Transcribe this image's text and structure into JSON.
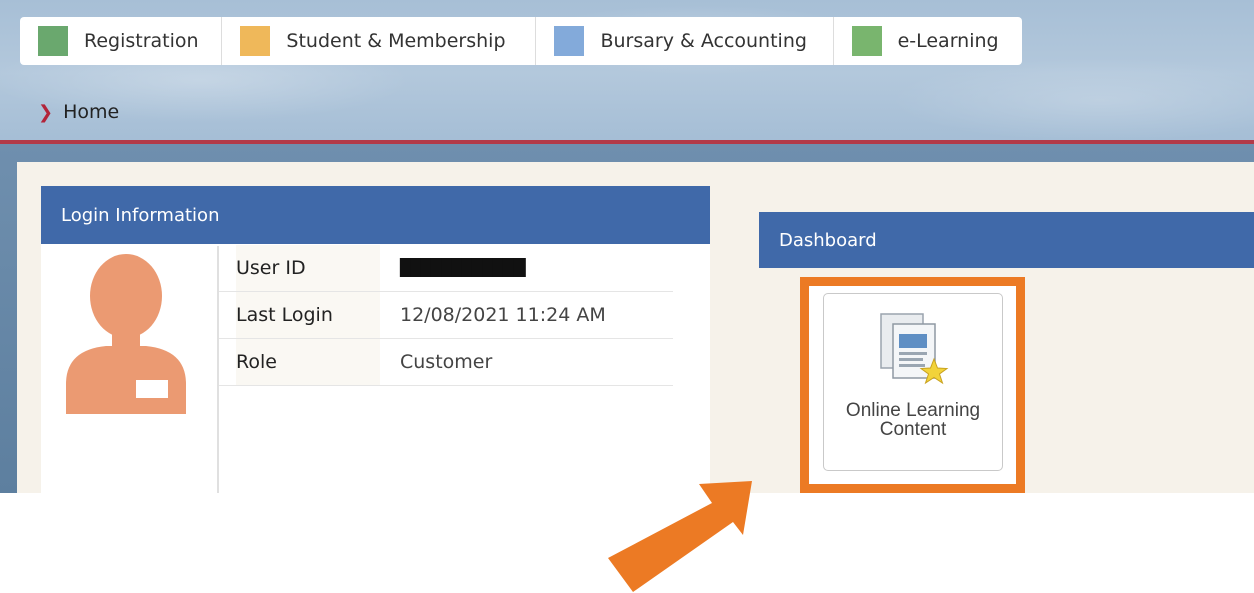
{
  "nav": {
    "tabs": [
      {
        "label": "Registration",
        "color": "#6aa86e"
      },
      {
        "label": "Student & Membership",
        "color": "#efb85a"
      },
      {
        "label": "Bursary & Accounting",
        "color": "#83aada"
      },
      {
        "label": "e-Learning",
        "color": "#79b56e"
      }
    ]
  },
  "breadcrumb": {
    "current": "Home"
  },
  "login": {
    "title": "Login Information",
    "rows": [
      {
        "key": "User ID",
        "value": "████████████"
      },
      {
        "key": "Last Login",
        "value": "12/08/2021 11:24 AM"
      },
      {
        "key": "Role",
        "value": "Customer"
      }
    ]
  },
  "dashboard": {
    "title": "Dashboard",
    "tile": {
      "line1": "Online Learning",
      "line2": "Content",
      "icon": "documents-star-icon"
    }
  },
  "colors": {
    "panel_header": "#4069a9",
    "highlight": "#ec7a24",
    "avatar": "#eb9a72"
  }
}
